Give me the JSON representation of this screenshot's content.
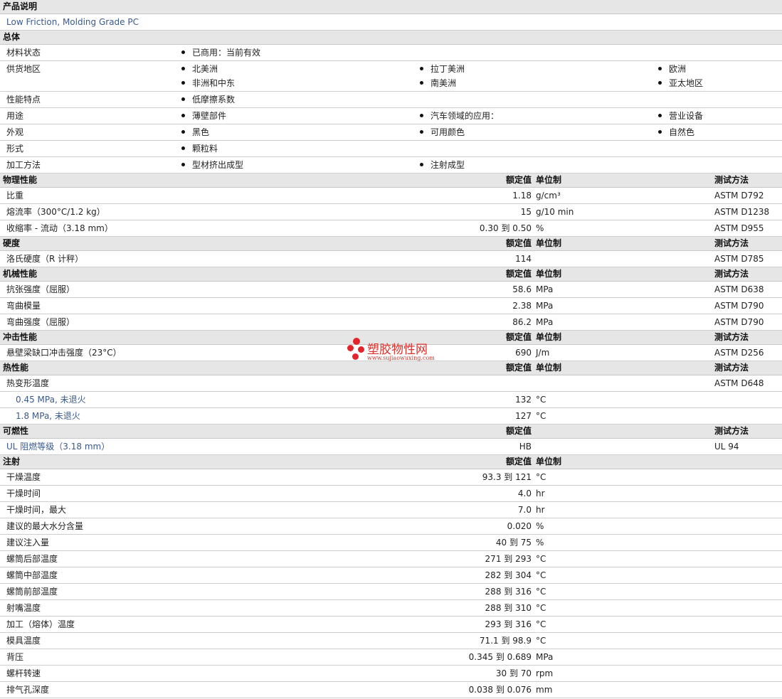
{
  "sections": {
    "desc": {
      "title": "产品说明",
      "text": "Low Friction, Molding Grade PC"
    },
    "general": {
      "title": "总体",
      "rows": [
        {
          "label": "材料状态",
          "items": [
            "已商用：当前有效"
          ]
        },
        {
          "label": "供货地区",
          "items": [
            "北美洲",
            "拉丁美洲",
            "欧洲",
            "非洲和中东",
            "南美洲",
            "亚太地区"
          ]
        },
        {
          "label": "性能特点",
          "items": [
            "低摩擦系数"
          ]
        },
        {
          "label": "用途",
          "items": [
            "薄壁部件",
            "汽车领域的应用：",
            "营业设备"
          ]
        },
        {
          "label": "外观",
          "items": [
            "黑色",
            "可用颜色",
            "自然色"
          ]
        },
        {
          "label": "形式",
          "items": [
            "颗粒料"
          ]
        },
        {
          "label": "加工方法",
          "items": [
            "型材挤出成型",
            "注射成型"
          ]
        }
      ]
    },
    "headers": {
      "nominal": "额定值",
      "unit": "单位制",
      "method": "测试方法"
    },
    "physical": {
      "title": "物理性能",
      "rows": [
        {
          "label": "比重",
          "value": "1.18",
          "unit": "g/cm³",
          "method": "ASTM D792"
        },
        {
          "label": "熔流率（300°C/1.2 kg）",
          "value": "15",
          "unit": "g/10 min",
          "method": "ASTM D1238"
        },
        {
          "label": "收缩率 - 流动（3.18 mm）",
          "value": "0.30 到  0.50",
          "unit": "%",
          "method": "ASTM D955"
        }
      ]
    },
    "hardness": {
      "title": "硬度",
      "rows": [
        {
          "label": "洛氏硬度（R 计秤）",
          "value": "114",
          "unit": "",
          "method": "ASTM D785"
        }
      ]
    },
    "mechanical": {
      "title": "机械性能",
      "rows": [
        {
          "label": "抗张强度（屈服）",
          "value": "58.6",
          "unit": "MPa",
          "method": "ASTM D638"
        },
        {
          "label": "弯曲模量",
          "value": "2.38",
          "unit": "MPa",
          "method": "ASTM D790"
        },
        {
          "label": "弯曲强度（屈服）",
          "value": "86.2",
          "unit": "MPa",
          "method": "ASTM D790"
        }
      ]
    },
    "impact": {
      "title": "冲击性能",
      "rows": [
        {
          "label": "悬壁梁缺口冲击强度（23°C）",
          "value": "690",
          "unit": "J/m",
          "method": "ASTM D256"
        }
      ]
    },
    "thermal": {
      "title": "热性能",
      "rows": [
        {
          "label": "热变形温度",
          "value": "",
          "unit": "",
          "method": "ASTM D648"
        },
        {
          "label": "0.45 MPa, 未退火",
          "value": "132",
          "unit": "°C",
          "method": ""
        },
        {
          "label": "1.8 MPa, 未退火",
          "value": "127",
          "unit": "°C",
          "method": ""
        }
      ]
    },
    "flammability": {
      "title": "可燃性",
      "rows": [
        {
          "label": "UL 阻燃等级（3.18 mm）",
          "value": "HB",
          "unit": "",
          "method": "UL 94"
        }
      ]
    },
    "injection": {
      "title": "注射",
      "rows": [
        {
          "label": "干燥温度",
          "value": "93.3 到  121",
          "unit": "°C"
        },
        {
          "label": "干燥时间",
          "value": "4.0",
          "unit": "hr"
        },
        {
          "label": "干燥时间，最大",
          "value": "7.0",
          "unit": "hr"
        },
        {
          "label": "建议的最大水分含量",
          "value": "0.020",
          "unit": "%"
        },
        {
          "label": "建议注入量",
          "value": "40 到  75",
          "unit": "%"
        },
        {
          "label": "螺筒后部温度",
          "value": "271 到  293",
          "unit": "°C"
        },
        {
          "label": "螺筒中部温度",
          "value": "282 到  304",
          "unit": "°C"
        },
        {
          "label": "螺筒前部温度",
          "value": "288 到  316",
          "unit": "°C"
        },
        {
          "label": "射嘴温度",
          "value": "288 到  310",
          "unit": "°C"
        },
        {
          "label": "加工（熔体）温度",
          "value": "293 到  316",
          "unit": "°C"
        },
        {
          "label": "模具温度",
          "value": "71.1 到  98.9",
          "unit": "°C"
        },
        {
          "label": "背压",
          "value": "0.345 到  0.689",
          "unit": "MPa"
        },
        {
          "label": "螺杆转速",
          "value": "30 到  70",
          "unit": "rpm"
        },
        {
          "label": "排气孔深度",
          "value": "0.038 到  0.076",
          "unit": "mm"
        }
      ]
    }
  },
  "watermark": {
    "text": "塑胶物性网",
    "url": "www.sujiaowuxing.com"
  }
}
